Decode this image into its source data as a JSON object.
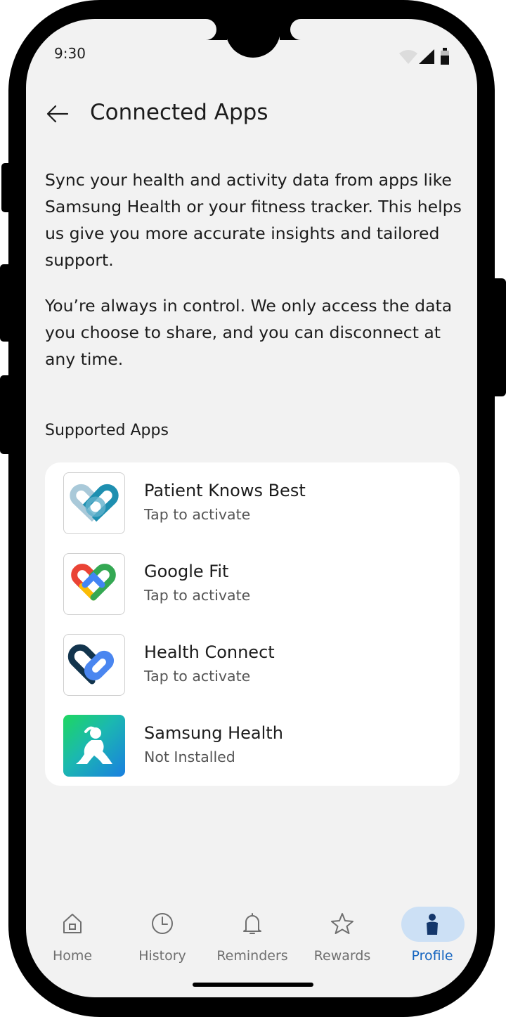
{
  "status_bar": {
    "time": "9:30",
    "icons": [
      "wifi-icon",
      "signal-icon",
      "battery-icon"
    ]
  },
  "header": {
    "back_icon": "arrow-left-icon",
    "title": "Connected Apps"
  },
  "intro": {
    "paragraph_1": "Sync your health and activity data from apps like Samsung Health or your fitness tracker. This helps us give you more accurate insights and tailored support.",
    "paragraph_2": "You’re always in control. We only access the data you choose to share, and you can disconnect at any time."
  },
  "supported_apps": {
    "label": "Supported Apps",
    "items": [
      {
        "name": "Patient Knows Best",
        "status": "Tap to activate",
        "icon": "patient-knows-best-icon"
      },
      {
        "name": "Google Fit",
        "status": "Tap to activate",
        "icon": "google-fit-icon"
      },
      {
        "name": "Health Connect",
        "status": "Tap to activate",
        "icon": "health-connect-icon"
      },
      {
        "name": "Samsung Health",
        "status": "Not Installed",
        "icon": "samsung-health-icon"
      }
    ]
  },
  "bottom_nav": {
    "items": [
      {
        "label": "Home",
        "icon": "home-icon",
        "active": false
      },
      {
        "label": "History",
        "icon": "clock-icon",
        "active": false
      },
      {
        "label": "Reminders",
        "icon": "bell-icon",
        "active": false
      },
      {
        "label": "Rewards",
        "icon": "star-icon",
        "active": false
      },
      {
        "label": "Profile",
        "icon": "person-icon",
        "active": true
      }
    ]
  },
  "colors": {
    "accent": "#1565c0",
    "active_pill": "#cce0f5",
    "background": "#f2f2f2",
    "card": "#ffffff"
  }
}
